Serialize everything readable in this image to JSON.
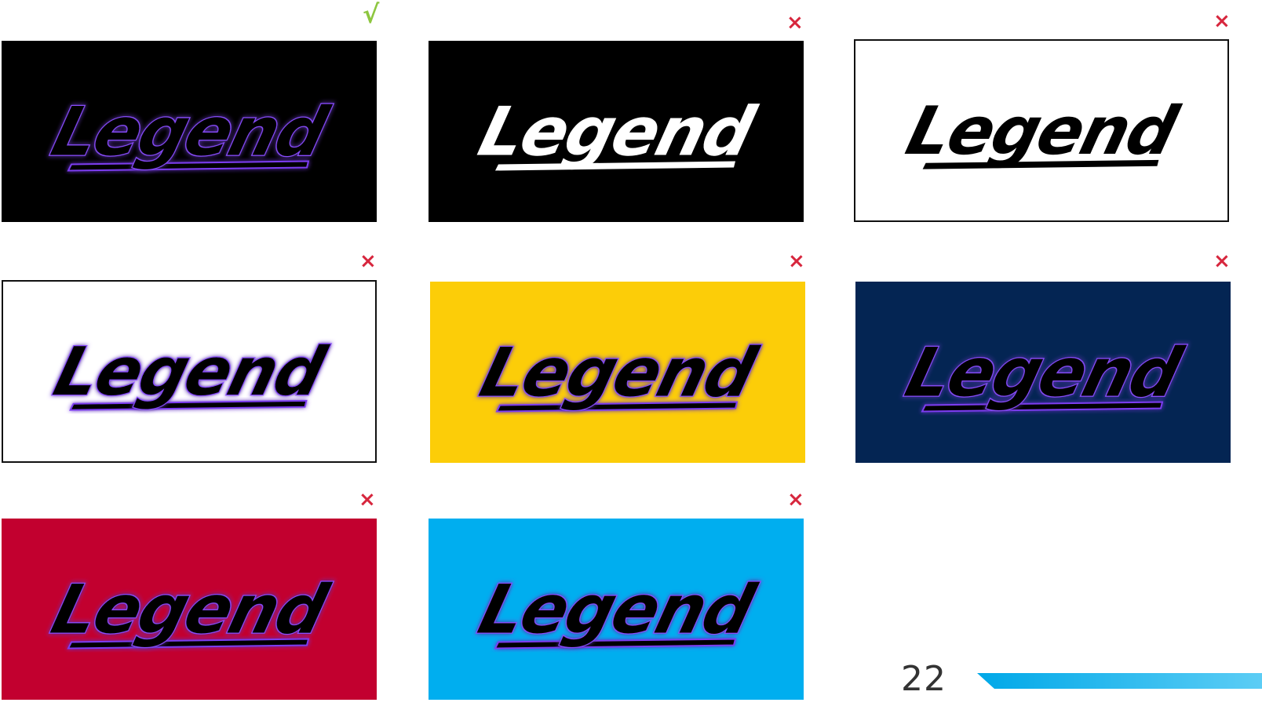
{
  "logo_text": "Legend",
  "page_number": "22",
  "colors": {
    "correct": "#8dc63f",
    "incorrect": "#d7263d",
    "accent_start": "#00a8e8",
    "accent_end": "#5ccdf5"
  },
  "variants": [
    {
      "background": "#000000",
      "logo_style": "black-fill-purple-glow",
      "mark": "√",
      "status": "correct",
      "bordered": false
    },
    {
      "background": "#000000",
      "logo_style": "white-fill",
      "mark": "×",
      "status": "incorrect",
      "bordered": false
    },
    {
      "background": "#ffffff",
      "logo_style": "black-fill",
      "mark": "×",
      "status": "incorrect",
      "bordered": true
    },
    {
      "background": "#ffffff",
      "logo_style": "black-fill-purple-glow",
      "mark": "×",
      "status": "incorrect",
      "bordered": true
    },
    {
      "background": "#fccd08",
      "logo_style": "black-fill-purple-glow",
      "mark": "×",
      "status": "incorrect",
      "bordered": false
    },
    {
      "background": "#042553",
      "logo_style": "black-fill-purple-glow",
      "mark": "×",
      "status": "incorrect",
      "bordered": false
    },
    {
      "background": "#c2002f",
      "logo_style": "black-fill-purple-glow",
      "mark": "×",
      "status": "incorrect",
      "bordered": false
    },
    {
      "background": "#00aeef",
      "logo_style": "black-fill-purple-glow",
      "mark": "×",
      "status": "incorrect",
      "bordered": false
    }
  ]
}
